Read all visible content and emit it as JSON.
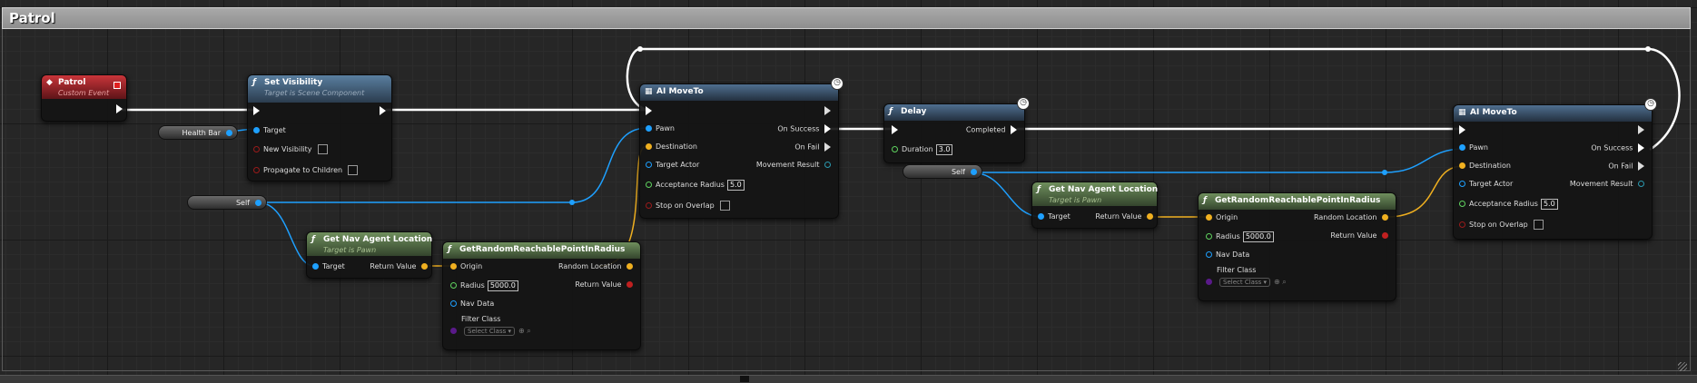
{
  "graph_title": "Patrol",
  "nodes": {
    "patrol_event": {
      "title": "Patrol",
      "subtitle": "Custom Event"
    },
    "set_visibility": {
      "title": "Set Visibility",
      "subtitle": "Target is Scene Component",
      "pins": {
        "target": "Target",
        "new_visibility": "New Visibility",
        "propagate": "Propagate to Children"
      }
    },
    "health_bar": {
      "label": "Health Bar"
    },
    "self_1": {
      "label": "Self"
    },
    "self_2": {
      "label": "Self"
    },
    "get_nav_1": {
      "title": "Get Nav Agent Location",
      "subtitle": "Target is Pawn",
      "pins": {
        "target": "Target",
        "return": "Return Value"
      }
    },
    "get_nav_2": {
      "title": "Get Nav Agent Location",
      "subtitle": "Target is Pawn",
      "pins": {
        "target": "Target",
        "return": "Return Value"
      }
    },
    "random_1": {
      "title": "GetRandomReachablePointInRadius",
      "pins": {
        "origin": "Origin",
        "radius": "Radius",
        "radius_value": "5000.0",
        "nav_data": "Nav Data",
        "filter_class": "Filter Class",
        "select_class": "Select Class",
        "random_location": "Random Location",
        "return": "Return Value"
      }
    },
    "random_2": {
      "title": "GetRandomReachablePointInRadius",
      "pins": {
        "origin": "Origin",
        "radius": "Radius",
        "radius_value": "5000.0",
        "nav_data": "Nav Data",
        "filter_class": "Filter Class",
        "select_class": "Select Class",
        "random_location": "Random Location",
        "return": "Return Value"
      }
    },
    "moveto_1": {
      "title": "AI MoveTo",
      "pins": {
        "pawn": "Pawn",
        "destination": "Destination",
        "target_actor": "Target Actor",
        "acceptance_radius": "Acceptance Radius",
        "acceptance_value": "5.0",
        "stop_on_overlap": "Stop on Overlap",
        "on_success": "On Success",
        "on_fail": "On Fail",
        "movement_result": "Movement Result"
      }
    },
    "moveto_2": {
      "title": "AI MoveTo",
      "pins": {
        "pawn": "Pawn",
        "destination": "Destination",
        "target_actor": "Target Actor",
        "acceptance_radius": "Acceptance Radius",
        "acceptance_value": "5.0",
        "stop_on_overlap": "Stop on Overlap",
        "on_success": "On Success",
        "on_fail": "On Fail",
        "movement_result": "Movement Result"
      }
    },
    "delay": {
      "title": "Delay",
      "pins": {
        "duration": "Duration",
        "duration_value": "3.0",
        "completed": "Completed"
      }
    }
  },
  "colors": {
    "exec_wire": "#ffffff",
    "object_wire": "#1ea0ff",
    "vector_wire": "#f0b020",
    "background": "#262626"
  }
}
